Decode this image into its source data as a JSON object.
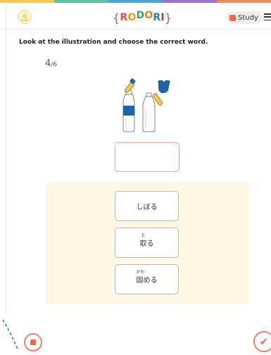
{
  "colors": {
    "stripe": [
      "#f7c948",
      "#5cc0a4",
      "#4aa3df",
      "#9b6fd0",
      "#f08a5d"
    ],
    "accent": "#ee6a4c",
    "panel": "#fff8e6",
    "answer_border": "#f3a88f"
  },
  "header": {
    "home_icon": "home-icon",
    "home_label": "HOME",
    "logo_letters": [
      "R",
      "O",
      "D",
      "O",
      "R",
      "I"
    ],
    "logo_colors": [
      "#e74c3c",
      "#f39c12",
      "#27ae60",
      "#e67e22",
      "#2980b9",
      "#c0392b"
    ],
    "study_label": "Study",
    "menu_icon": "menu-icon"
  },
  "instruction": "Look at the illustration and choose the correct word.",
  "progress": {
    "current": "4",
    "total": "/6"
  },
  "choices": [
    {
      "ruby": "",
      "text": "しぼる"
    },
    {
      "ruby": "と",
      "text": "取る"
    },
    {
      "ruby": "かた",
      "text": "固める"
    }
  ]
}
